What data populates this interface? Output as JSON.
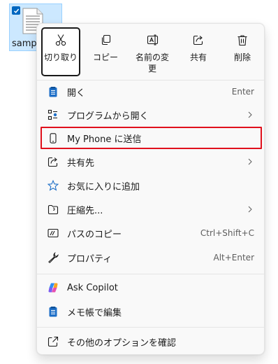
{
  "desktop": {
    "file_name": "samp"
  },
  "toolbar": {
    "buttons": [
      {
        "label": "切り取り",
        "icon": "scissors-icon"
      },
      {
        "label": "コピー",
        "icon": "copy-icon"
      },
      {
        "label": "名前の変更",
        "icon": "rename-icon"
      },
      {
        "label": "共有",
        "icon": "share-icon"
      },
      {
        "label": "削除",
        "icon": "trash-icon"
      }
    ]
  },
  "menu": {
    "items": [
      {
        "label": "開く",
        "shortcut": "Enter",
        "icon": "notepad-icon"
      },
      {
        "label": "プログラムから開く",
        "icon": "open-with-icon"
      },
      {
        "label": "My Phone に送信",
        "icon": "phone-icon"
      },
      {
        "label": "共有先",
        "icon": "share-to-icon"
      },
      {
        "label": "お気に入りに追加",
        "icon": "star-icon"
      },
      {
        "label": "圧縮先...",
        "icon": "zip-icon"
      },
      {
        "label": "パスのコピー",
        "shortcut": "Ctrl+Shift+C",
        "icon": "path-icon"
      },
      {
        "label": "プロパティ",
        "shortcut": "Alt+Enter",
        "icon": "wrench-icon"
      },
      {
        "label": "Ask Copilot",
        "icon": "copilot-icon"
      },
      {
        "label": "メモ帳で編集",
        "icon": "notepad-icon"
      },
      {
        "label": "その他のオプションを確認",
        "icon": "more-options-icon"
      }
    ]
  },
  "colors": {
    "highlight_border": "#e0101c",
    "accent": "#0067c0"
  }
}
